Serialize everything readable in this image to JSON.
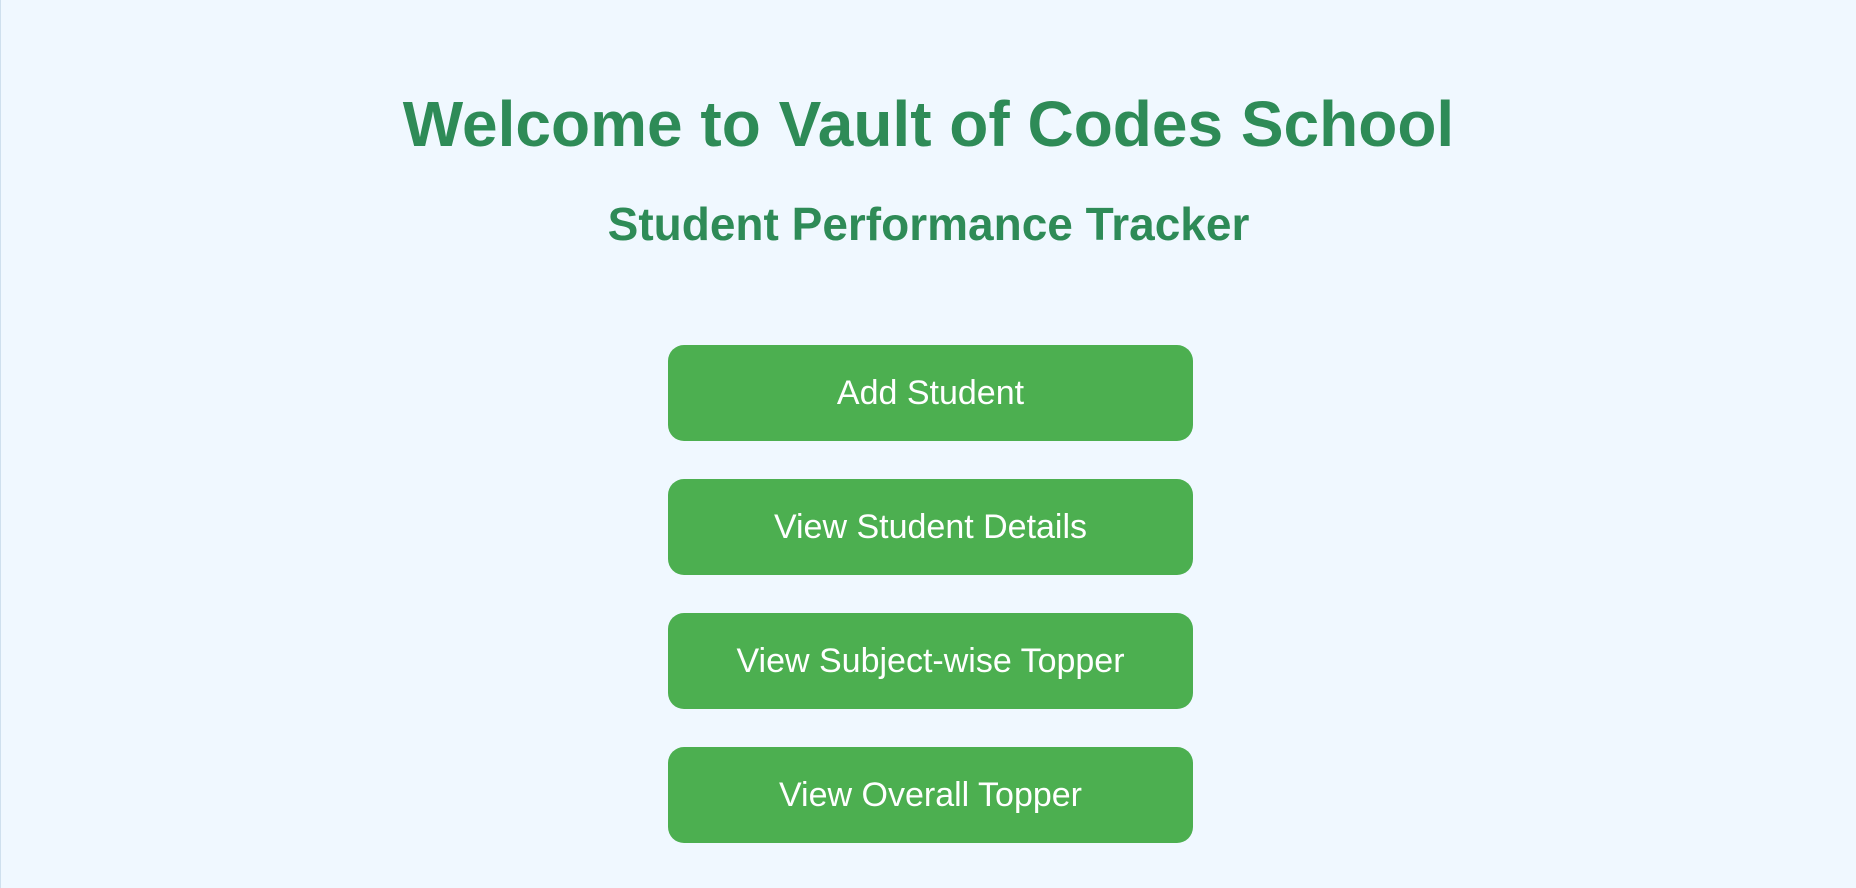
{
  "header": {
    "title": "Welcome to Vault of Codes School",
    "subtitle": "Student Performance Tracker"
  },
  "menu": {
    "buttons": [
      {
        "label": "Add Student"
      },
      {
        "label": "View Student Details"
      },
      {
        "label": "View Subject-wise Topper"
      },
      {
        "label": "View Overall Topper"
      }
    ]
  },
  "colors": {
    "background": "#f0f8ff",
    "heading": "#2e8b57",
    "button": "#4caf50",
    "button_text": "#ffffff"
  }
}
